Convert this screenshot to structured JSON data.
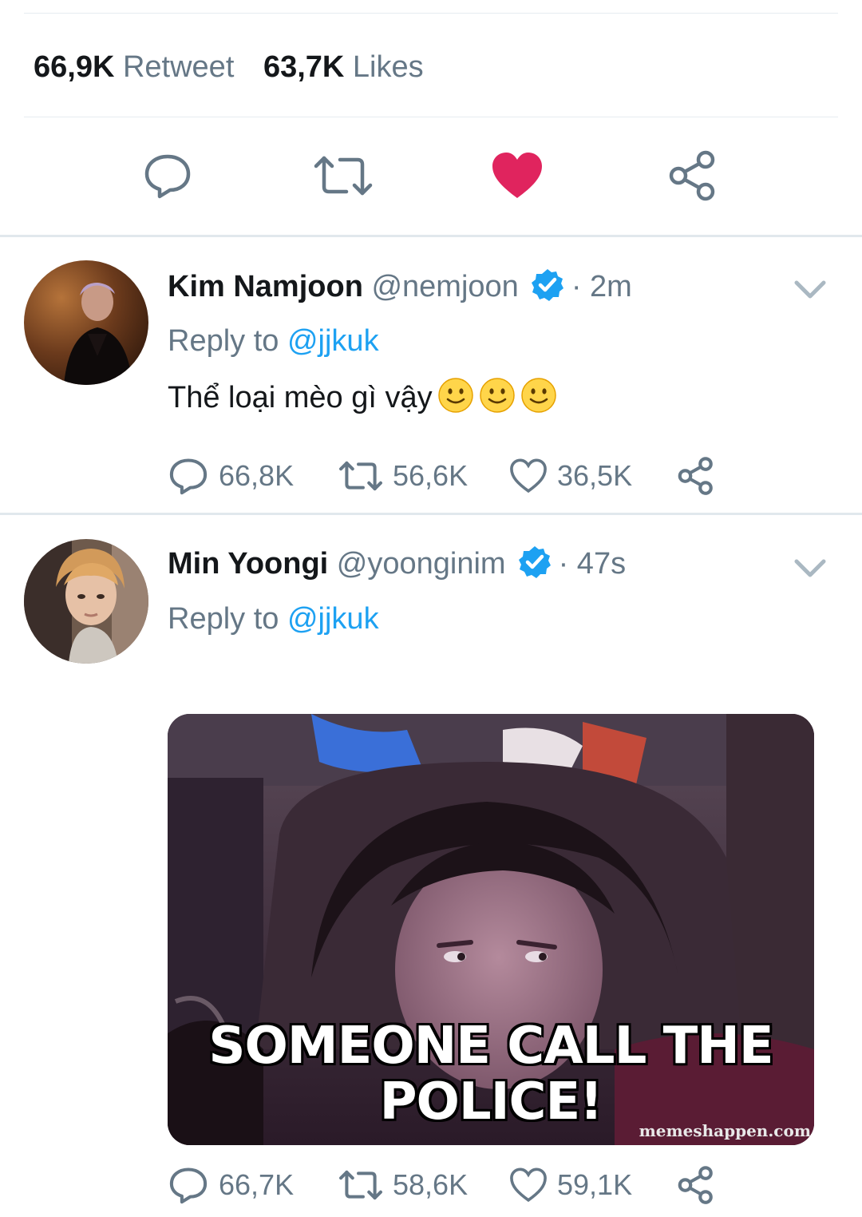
{
  "tweet_stats": {
    "retweets_count": "66,9K",
    "retweets_label": "Retweet",
    "likes_count": "63,7K",
    "likes_label": "Likes"
  },
  "main_actions": {
    "icons": [
      "reply-icon",
      "retweet-icon",
      "heart-filled-icon",
      "share-icon"
    ],
    "liked": true,
    "like_color": "#e0245e"
  },
  "colors": {
    "text": "#14171a",
    "muted": "#657786",
    "accent": "#1da1f2",
    "divider": "#e1e8ed"
  },
  "replies": [
    {
      "name": "Kim Namjoon",
      "handle": "@nemjoon",
      "verified": true,
      "time": "· 2m",
      "reply_prefix": "Reply to",
      "reply_mention": "@jjkuk",
      "text": "Thể loại mèo gì vậy",
      "emojis": [
        "slightly-smiling-face",
        "slightly-smiling-face",
        "slightly-smiling-face"
      ],
      "reply_count": "66,8K",
      "retweet_count": "56,6K",
      "like_count": "36,5K"
    },
    {
      "name": "Min Yoongi",
      "handle": "@yoonginim",
      "verified": true,
      "time": "· 47s",
      "reply_prefix": "Reply to",
      "reply_mention": "@jjkuk",
      "media": {
        "caption_line1": "SOMEONE CALL THE",
        "caption_line2": "POLICE!",
        "watermark": "memeshappen.com"
      },
      "reply_count": "66,7K",
      "retweet_count": "58,6K",
      "like_count": "59,1K"
    }
  ]
}
